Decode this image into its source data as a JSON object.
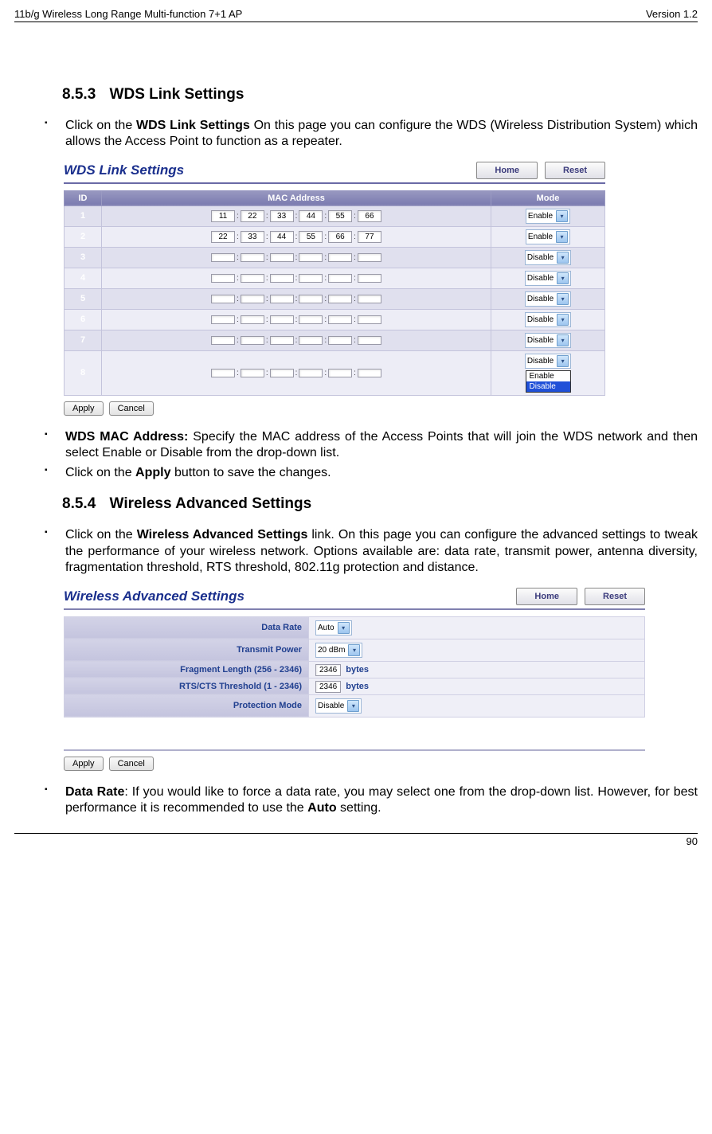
{
  "header": {
    "left": "11b/g Wireless Long Range Multi-function 7+1 AP",
    "right": "Version 1.2"
  },
  "section1": {
    "num": "8.5.3",
    "title": "WDS Link Settings"
  },
  "bullets1": [
    {
      "pre": "Click on the ",
      "bold": "WDS Link Settings",
      "post": "  On this page you can configure the WDS (Wireless Distribution System) which allows the Access Point to function as a repeater."
    }
  ],
  "wds": {
    "title": "WDS Link Settings",
    "home_btn": "Home",
    "reset_btn": "Reset",
    "col_id": "ID",
    "col_mac": "MAC Address",
    "col_mode": "Mode",
    "rows": [
      {
        "id": "1",
        "mac": [
          "11",
          "22",
          "33",
          "44",
          "55",
          "66"
        ],
        "mode": "Enable"
      },
      {
        "id": "2",
        "mac": [
          "22",
          "33",
          "44",
          "55",
          "66",
          "77"
        ],
        "mode": "Enable"
      },
      {
        "id": "3",
        "mac": [
          "",
          "",
          "",
          "",
          "",
          ""
        ],
        "mode": "Disable"
      },
      {
        "id": "4",
        "mac": [
          "",
          "",
          "",
          "",
          "",
          ""
        ],
        "mode": "Disable"
      },
      {
        "id": "5",
        "mac": [
          "",
          "",
          "",
          "",
          "",
          ""
        ],
        "mode": "Disable"
      },
      {
        "id": "6",
        "mac": [
          "",
          "",
          "",
          "",
          "",
          ""
        ],
        "mode": "Disable"
      },
      {
        "id": "7",
        "mac": [
          "",
          "",
          "",
          "",
          "",
          ""
        ],
        "mode": "Disable"
      },
      {
        "id": "8",
        "mac": [
          "",
          "",
          "",
          "",
          "",
          ""
        ],
        "mode": "Disable"
      }
    ],
    "dropdown_opts": [
      "Enable",
      "Disable"
    ],
    "apply": "Apply",
    "cancel": "Cancel"
  },
  "bullets2": [
    {
      "bold": "WDS MAC Address:",
      "post": " Specify the MAC address of the Access Points that will join the WDS network and then select Enable or Disable from the drop-down list."
    },
    {
      "pre": "Click on the ",
      "bold": "Apply",
      "post": " button to save the changes."
    }
  ],
  "section2": {
    "num": "8.5.4",
    "title": "Wireless Advanced Settings"
  },
  "bullets3": [
    {
      "pre": "Click on the ",
      "bold": "Wireless Advanced Settings",
      "post": " link. On this page you can configure the advanced settings to tweak the performance of your wireless network. Options available are: data rate, transmit power, antenna diversity, fragmentation threshold, RTS threshold, 802.11g protection and distance."
    }
  ],
  "adv": {
    "title": "Wireless Advanced Settings",
    "home_btn": "Home",
    "reset_btn": "Reset",
    "rows": [
      {
        "label": "Data Rate",
        "type": "select",
        "value": "Auto"
      },
      {
        "label": "Transmit Power",
        "type": "select",
        "value": "20 dBm"
      },
      {
        "label": "Fragment Length (256 - 2346)",
        "type": "text",
        "value": "2346",
        "unit": "bytes"
      },
      {
        "label": "RTS/CTS Threshold (1 - 2346)",
        "type": "text",
        "value": "2346",
        "unit": "bytes"
      },
      {
        "label": "Protection Mode",
        "type": "select",
        "value": "Disable"
      }
    ],
    "apply": "Apply",
    "cancel": "Cancel"
  },
  "bullets4": [
    {
      "bold": "Data Rate",
      "post": ": If you would like to force a data rate, you may select one from the drop-down list. However, for best performance it is recommended to use the ",
      "bold2": "Auto",
      "post2": " setting."
    }
  ],
  "footer": {
    "page": "90"
  }
}
